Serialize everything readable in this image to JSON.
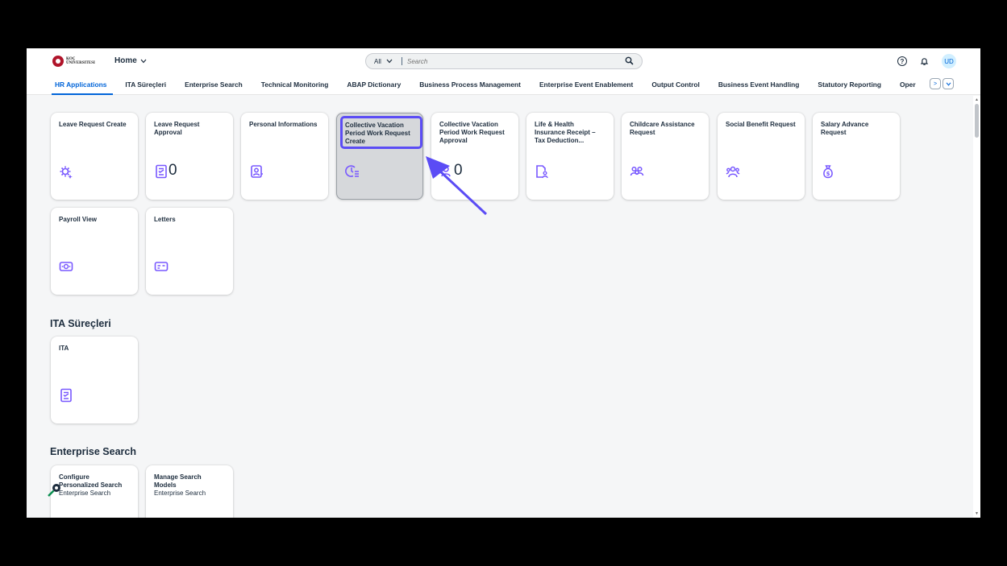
{
  "header": {
    "logo_line1": "KOÇ",
    "logo_line2": "ÜNIVERSITESI",
    "home_label": "Home",
    "search_scope": "All",
    "search_placeholder": "Search",
    "avatar_initials": "UD"
  },
  "tabs": [
    "HR Applications",
    "ITA Süreçleri",
    "Enterprise Search",
    "Technical Monitoring",
    "ABAP Dictionary",
    "Business Process Management",
    "Enterprise Event Enablement",
    "Output Control",
    "Business Event Handling",
    "Statutory Reporting",
    "Oper"
  ],
  "sections": {
    "ita": "ITA Süreçleri",
    "search": "Enterprise Search"
  },
  "tiles": {
    "leave_create": {
      "title": "Leave Request Create",
      "icon": "settings-star-icon"
    },
    "leave_approval": {
      "title": "Leave Request Approval",
      "count": "0",
      "icon": "checklist-icon"
    },
    "personal": {
      "title": "Personal Informations",
      "icon": "person-card-icon"
    },
    "cv_create": {
      "title": "Collective Vacation Period Work Request Create",
      "icon": "time-list-icon"
    },
    "cv_approval": {
      "title": "Collective Vacation Period Work Request Approval",
      "count": "0",
      "icon": "person-check-icon"
    },
    "life_health": {
      "title": "Life & Health Insurance Receipt – Tax Deduction...",
      "icon": "document-person-icon"
    },
    "childcare": {
      "title": "Childcare Assistance Request",
      "icon": "group-icon"
    },
    "social": {
      "title": "Social Benefit Request",
      "icon": "team-icon"
    },
    "salary": {
      "title": "Salary Advance Request",
      "icon": "money-bag-icon"
    },
    "payroll": {
      "title": "Payroll View",
      "icon": "money-icon"
    },
    "letters": {
      "title": "Letters",
      "icon": "card-icon"
    },
    "ita": {
      "title": "ITA",
      "icon": "checklist-icon"
    },
    "config_search": {
      "title": "Configure Personalized Search",
      "subtitle": "Enterprise Search"
    },
    "manage_models": {
      "title": "Manage Search Models",
      "subtitle": "Enterprise Search"
    }
  },
  "colors": {
    "accent": "#0064d9",
    "icon_purple": "#7858ff",
    "highlight": "#5b4cf5"
  }
}
